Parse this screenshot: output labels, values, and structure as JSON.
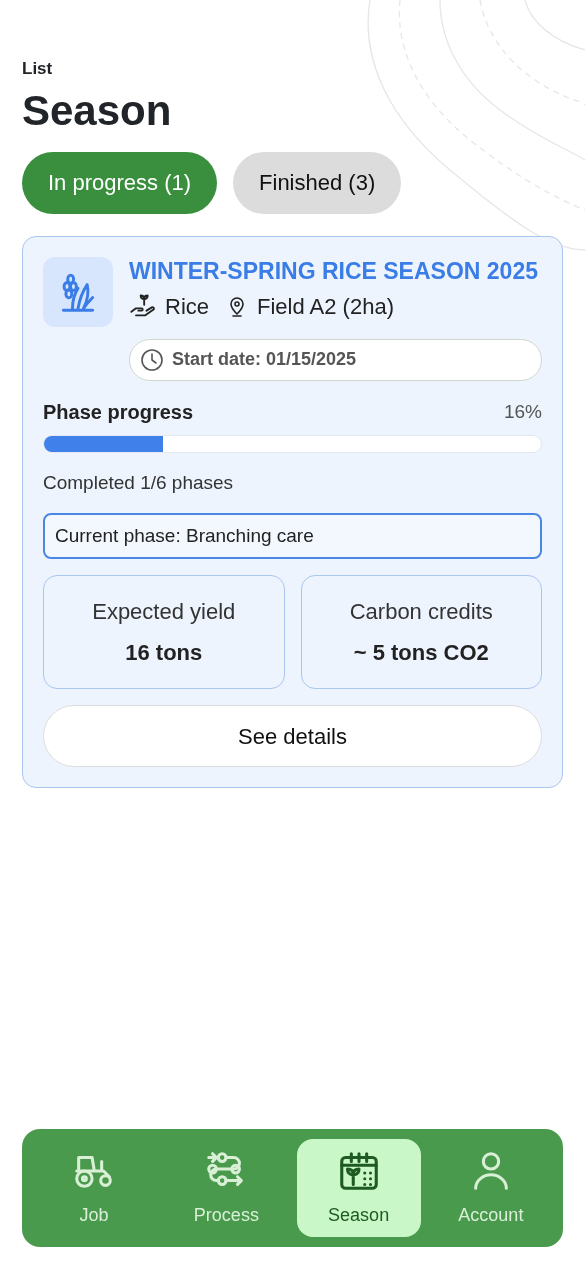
{
  "header": {
    "eyebrow": "List",
    "title": "Season"
  },
  "tabs": [
    {
      "label": "In progress (1)",
      "selected": true
    },
    {
      "label": "Finished (3)",
      "selected": false
    }
  ],
  "season_card": {
    "title": "WINTER-SPRING RICE SEASON 2025",
    "meta": [
      {
        "text": "Rice"
      },
      {
        "text": "Field A2 (2ha)"
      }
    ],
    "start_date": "Start date: 01/15/2025",
    "progress": {
      "label": "Phase progress",
      "percent": "16%",
      "level": 0.24
    },
    "completed": "Completed 1/6 phases",
    "current_phase": "Current phase: Branching care",
    "stats": [
      {
        "label": "Expected yield",
        "value": "16 tons"
      },
      {
        "label": "Carbon credits",
        "value": "~ 5 tons CO2"
      }
    ],
    "button": "See details"
  },
  "bottom_nav": [
    {
      "label": "Job",
      "selected": false
    },
    {
      "label": "Process",
      "selected": false
    },
    {
      "label": "Season",
      "selected": true
    },
    {
      "label": "Account",
      "selected": false
    }
  ]
}
